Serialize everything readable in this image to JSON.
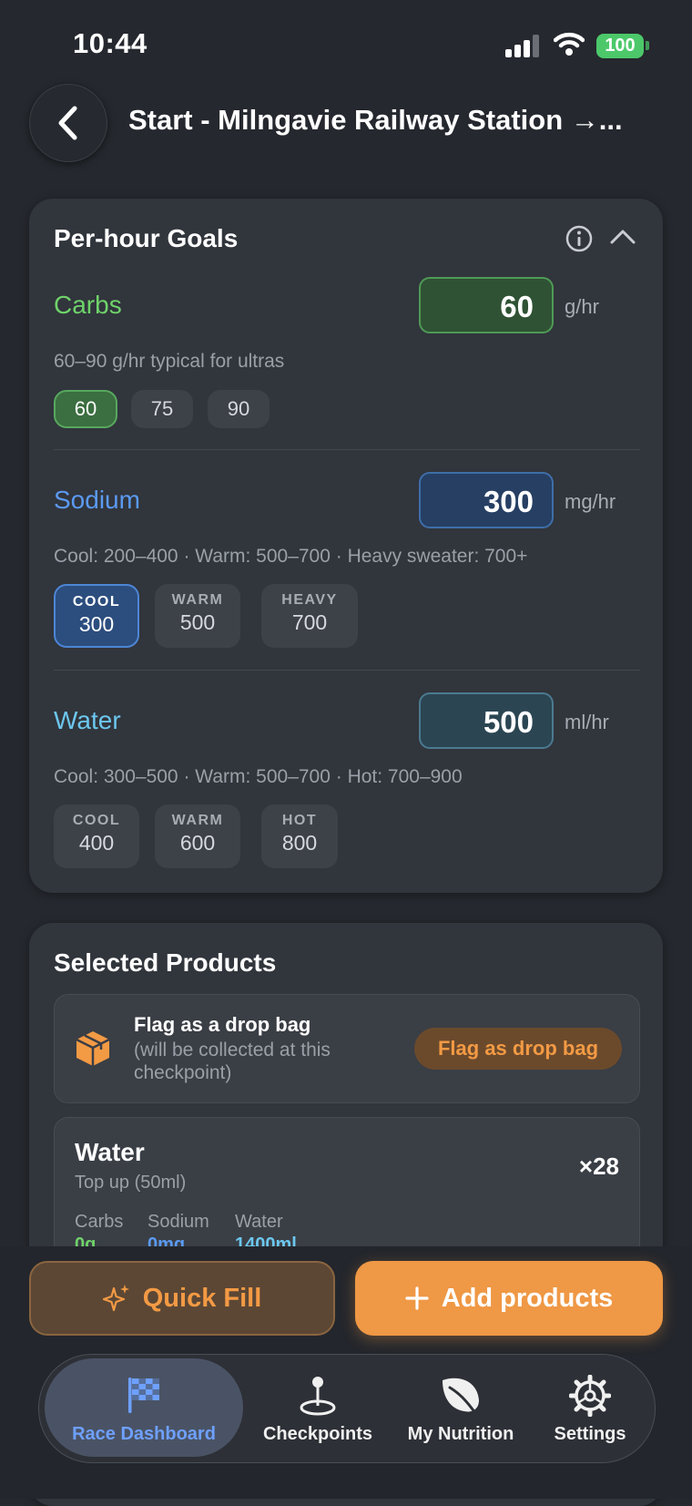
{
  "status_bar": {
    "time": "10:44",
    "battery": "100"
  },
  "header": {
    "title": "Start - Milngavie Railway Station →..."
  },
  "goals": {
    "title": "Per-hour Goals",
    "carbs": {
      "label": "Carbs",
      "value": "60",
      "unit": "g/hr",
      "hint": "60–90 g/hr typical for ultras",
      "chips": [
        "60",
        "75",
        "90"
      ],
      "selected": "60",
      "color": "#6fd36a"
    },
    "sodium": {
      "label": "Sodium",
      "value": "300",
      "unit": "mg/hr",
      "hint": "Cool: 200–400 · Warm: 500–700 · Heavy sweater: 700+",
      "chips": [
        {
          "k": "COOL",
          "v": "300"
        },
        {
          "k": "WARM",
          "v": "500"
        },
        {
          "k": "HEAVY",
          "v": "700"
        }
      ],
      "selected": "COOL",
      "color": "#5b9af2"
    },
    "water": {
      "label": "Water",
      "value": "500",
      "unit": "ml/hr",
      "hint": "Cool: 300–500 · Warm: 500–700 · Hot: 700–900",
      "chips": [
        {
          "k": "COOL",
          "v": "400"
        },
        {
          "k": "WARM",
          "v": "600"
        },
        {
          "k": "HOT",
          "v": "800"
        }
      ],
      "color": "#6cc7ee"
    }
  },
  "products": {
    "title": "Selected Products",
    "drop_bag": {
      "title": "Flag as a drop bag",
      "subtitle": "(will be collected at this checkpoint)",
      "button": "Flag as drop bag"
    },
    "items": [
      {
        "name": "Water",
        "subtitle": "Top up (50ml)",
        "qty": "×28",
        "carbs_label": "Carbs",
        "carbs": "0g",
        "sodium_label": "Sodium",
        "sodium": "0mg",
        "water_label": "Water",
        "water": "1400ml"
      }
    ]
  },
  "actions": {
    "quick_fill": "Quick Fill",
    "add_products": "Add products"
  },
  "tabs": [
    {
      "label": "Race Dashboard",
      "icon": "checkered-flag-icon",
      "active": true
    },
    {
      "label": "Checkpoints",
      "icon": "map-pin-icon",
      "active": false
    },
    {
      "label": "My Nutrition",
      "icon": "leaf-icon",
      "active": false
    },
    {
      "label": "Settings",
      "icon": "gear-icon",
      "active": false
    }
  ],
  "colors": {
    "accent_orange": "#ef9845",
    "active_tab": "#6ea0ff",
    "background": "#25282e",
    "card": "#31353c"
  }
}
